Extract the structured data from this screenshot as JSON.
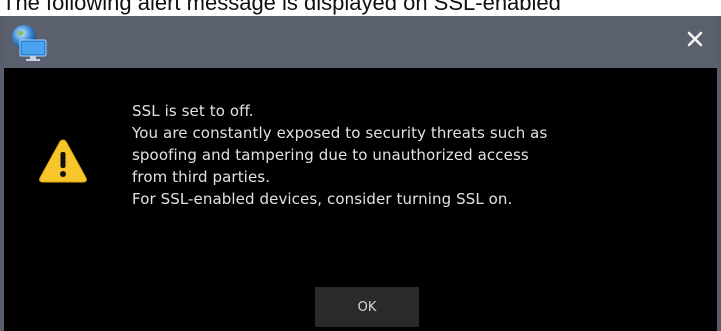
{
  "caption": {
    "text": "The following alert message is displayed on SSL-enabled"
  },
  "dialog": {
    "titlebar_color": "#5a606d",
    "app_icon": "globe-monitor-icon",
    "close_icon": "close-icon",
    "warning_icon": "warning-triangle-icon",
    "message_lines": [
      "SSL is set to off.",
      "You are constantly exposed to security threats such as",
      "spoofing and tampering due to unauthorized access",
      "from third parties.",
      "For SSL-enabled devices, consider turning SSL on."
    ],
    "ok_label": "OK"
  }
}
